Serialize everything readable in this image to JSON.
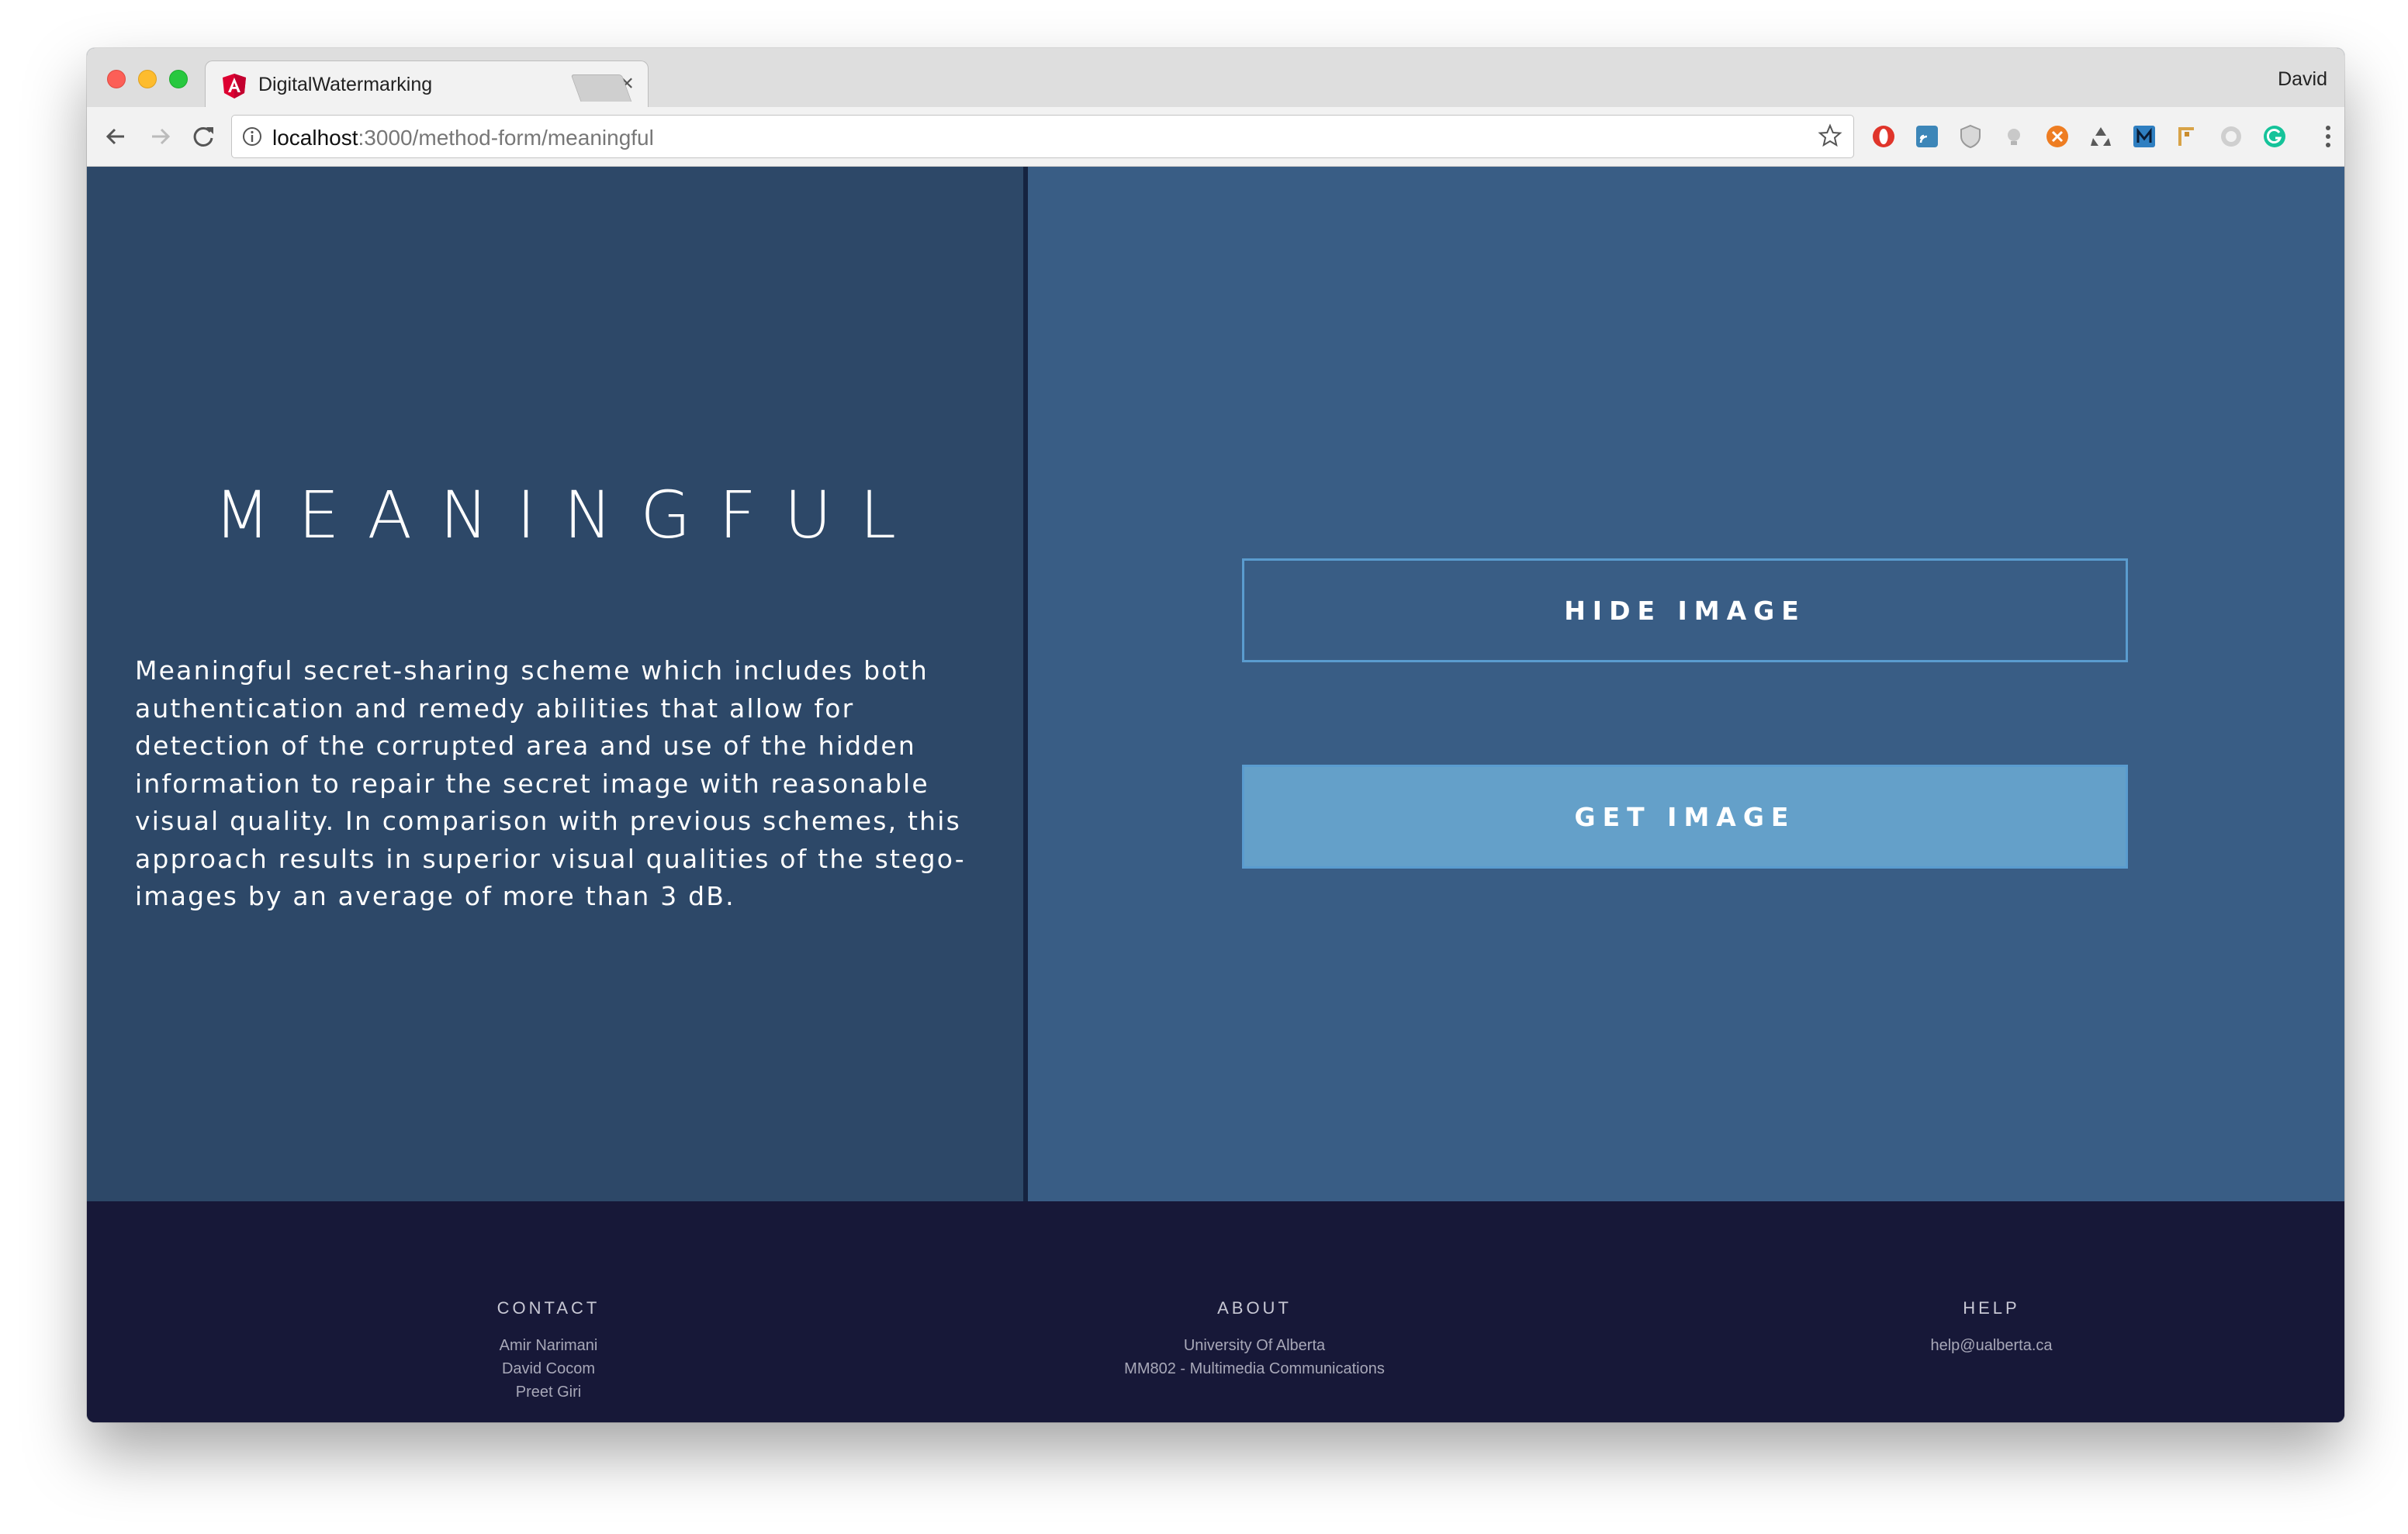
{
  "browser": {
    "tab_title": "DigitalWatermarking",
    "tab_close": "×",
    "profile_name": "David",
    "url_host": "localhost",
    "url_path": ":3000/method-form/meaningful"
  },
  "page": {
    "title": "MEANINGFUL",
    "description": "Meaningful secret-sharing scheme which includes both authentication and remedy abilities that allow for detection of the corrupted area and use of the hidden information to repair the secret image with reasonable visual quality. In comparison with previous schemes, this approach results in superior visual qualities of the stego-images by an average of more than 3 dB.",
    "hide_button": "HIDE IMAGE",
    "get_button": "GET IMAGE"
  },
  "footer": {
    "contact": {
      "heading": "CONTACT",
      "lines": [
        "Amir Narimani",
        "David Cocom",
        "Preet Giri"
      ]
    },
    "about": {
      "heading": "ABOUT",
      "lines": [
        "University Of Alberta",
        "MM802 - Multimedia Communications"
      ]
    },
    "help": {
      "heading": "HELP",
      "lines": [
        "help@ualberta.ca"
      ]
    }
  },
  "colors": {
    "left_panel": "#2d4868",
    "right_panel": "#395d85",
    "footer": "#171838",
    "get_button": "#64a0c9",
    "button_border": "#5a9ccf"
  },
  "icons": {
    "extensions": [
      "opera-icon",
      "cast-icon",
      "shield-icon",
      "bulb-icon",
      "ublock-icon",
      "recycle-icon",
      "m-extension-icon",
      "pen-icon",
      "ghost-icon",
      "grammarly-icon"
    ]
  }
}
